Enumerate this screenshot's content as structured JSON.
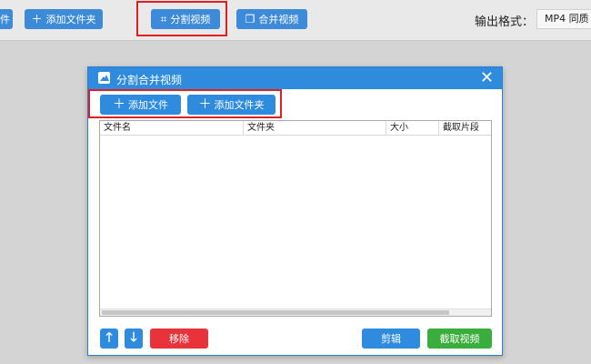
{
  "toolbar": {
    "left_cut_label": "件",
    "add_folder_label": "添加文件夹",
    "split_video_label": "分割视频",
    "merge_video_label": "合并视频",
    "output_format_label": "输出格式：",
    "output_format_value": "MP4 同质"
  },
  "dialog": {
    "title": "分割合并视频",
    "close_glyph": "✕",
    "add_file_label": "添加文件",
    "add_folder_label": "添加文件夹",
    "columns": [
      "文件名",
      "文件夹",
      "大小",
      "截取片段"
    ],
    "rows": [],
    "move_up_glyph": "🡑",
    "move_down_glyph": "🡓",
    "remove_label": "移除",
    "edit_label": "剪辑",
    "capture_label": "截取视频"
  },
  "colors": {
    "accent": "#2f8bde",
    "highlight": "#e02020",
    "remove": "#e8333b",
    "capture": "#3aae3c"
  }
}
